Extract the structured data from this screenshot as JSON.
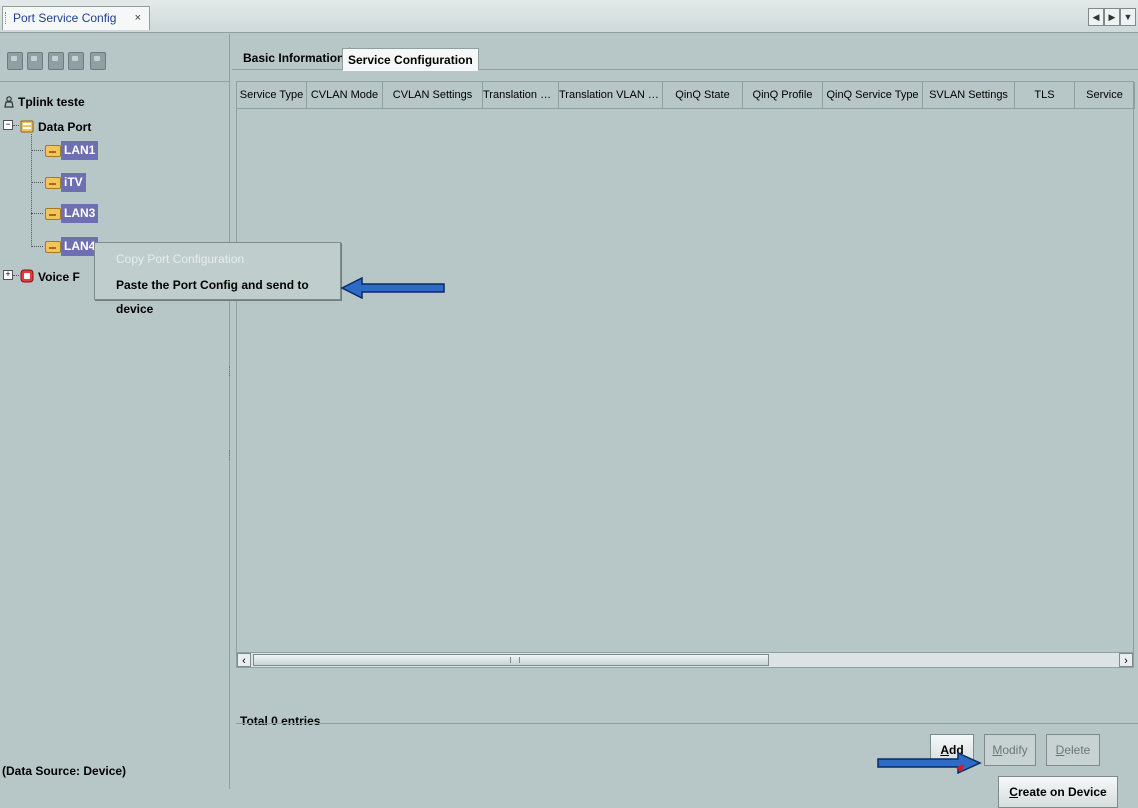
{
  "document_tab": {
    "title": "Port Service Config",
    "close": "×"
  },
  "tab_nav": {
    "prev": "◀",
    "next": "▶",
    "menu": "▼"
  },
  "left_panel": {
    "tree": {
      "root": "Tplink teste",
      "data_port": "Data Port",
      "lan_items": [
        "LAN1",
        "iTV",
        "LAN3",
        "LAN4"
      ],
      "voice_port_visible": "Voice F"
    },
    "data_source": "(Data Source: Device)"
  },
  "context_menu": {
    "items": [
      {
        "label": "Copy Port Configuration",
        "enabled": false
      },
      {
        "label": "Paste the Port Config and send to device",
        "enabled": true
      }
    ]
  },
  "main_panel": {
    "tabs": [
      {
        "label": "Basic Information"
      },
      {
        "label": "Service Configuration",
        "active": true
      }
    ],
    "table": {
      "columns": [
        "Service Type",
        "CVLAN Mode",
        "CVLAN Settings",
        "Translation St...",
        "Translation VLAN S...",
        "QinQ State",
        "QinQ Profile",
        "QinQ Service Type",
        "SVLAN Settings",
        "TLS",
        "Service"
      ],
      "rows": []
    },
    "entries_label": "Total 0 entries",
    "buttons": {
      "add": "Add",
      "modify": "Modify",
      "delete": "Delete",
      "create": "Create on Device"
    }
  },
  "colors": {
    "background": "#b7c6c6",
    "selection": "#6e6fb2",
    "arrow": "#2d6bc7"
  }
}
